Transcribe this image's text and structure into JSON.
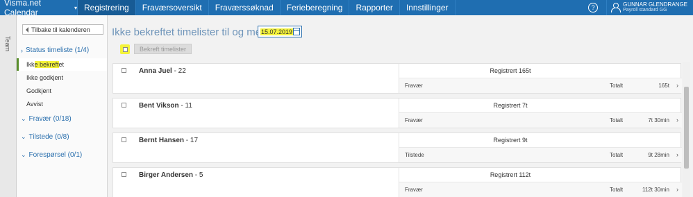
{
  "app": {
    "title": "Visma.net Calendar"
  },
  "nav": [
    {
      "label": "Registrering",
      "active": true
    },
    {
      "label": "Fraværsoversikt",
      "active": false
    },
    {
      "label": "Fraværssøknad",
      "active": false
    },
    {
      "label": "Ferieberegning",
      "active": false
    },
    {
      "label": "Rapporter",
      "active": false
    },
    {
      "label": "Innstillinger",
      "active": false
    }
  ],
  "user": {
    "name": "GUNNAR GLENDRANGE",
    "role": "Payroll standard GG",
    "help": "?"
  },
  "team": {
    "label": "Team"
  },
  "sidebar": {
    "back_label": "Tilbake til kalenderen",
    "status_group": "Status timeliste (1/4)",
    "status_items": [
      {
        "pre": "Ikk",
        "hl": "e bekreft",
        "post": "et",
        "active": true
      },
      {
        "pre": "Ikke godkjent",
        "hl": "",
        "post": "",
        "active": false
      },
      {
        "pre": "Godkjent",
        "hl": "",
        "post": "",
        "active": false
      },
      {
        "pre": "Avvist",
        "hl": "",
        "post": "",
        "active": false
      }
    ],
    "groups": [
      "Fravær (0/18)",
      "Tilstede (0/8)",
      "Forespørsel (0/1)"
    ]
  },
  "main": {
    "title": "Ikke bekreftet timelister til og med",
    "date": "15.07.2019",
    "confirm_label": "Bekreft timelister",
    "total_label": "Totalt",
    "rows": [
      {
        "name": "Anna Juel",
        "num": "- 22",
        "registered": "Registrert 165t",
        "category": "Fravær",
        "total": "165t"
      },
      {
        "name": "Bent Vikson",
        "num": "- 11",
        "registered": "Registrert 7t",
        "category": "Fravær",
        "total": "7t 30min"
      },
      {
        "name": "Bernt Hansen",
        "num": "- 17",
        "registered": "Registrert 9t",
        "category": "Tilstede",
        "total": "9t 28min"
      },
      {
        "name": "Birger Andersen",
        "num": "- 5",
        "registered": "Registrert 112t",
        "category": "Fravær",
        "total": "112t 30min"
      }
    ]
  },
  "colors": {
    "topbar": "#1f6eb1",
    "accent": "#2a6fad",
    "highlight": "#f4f33a",
    "active_marker": "#5b8f2d"
  }
}
